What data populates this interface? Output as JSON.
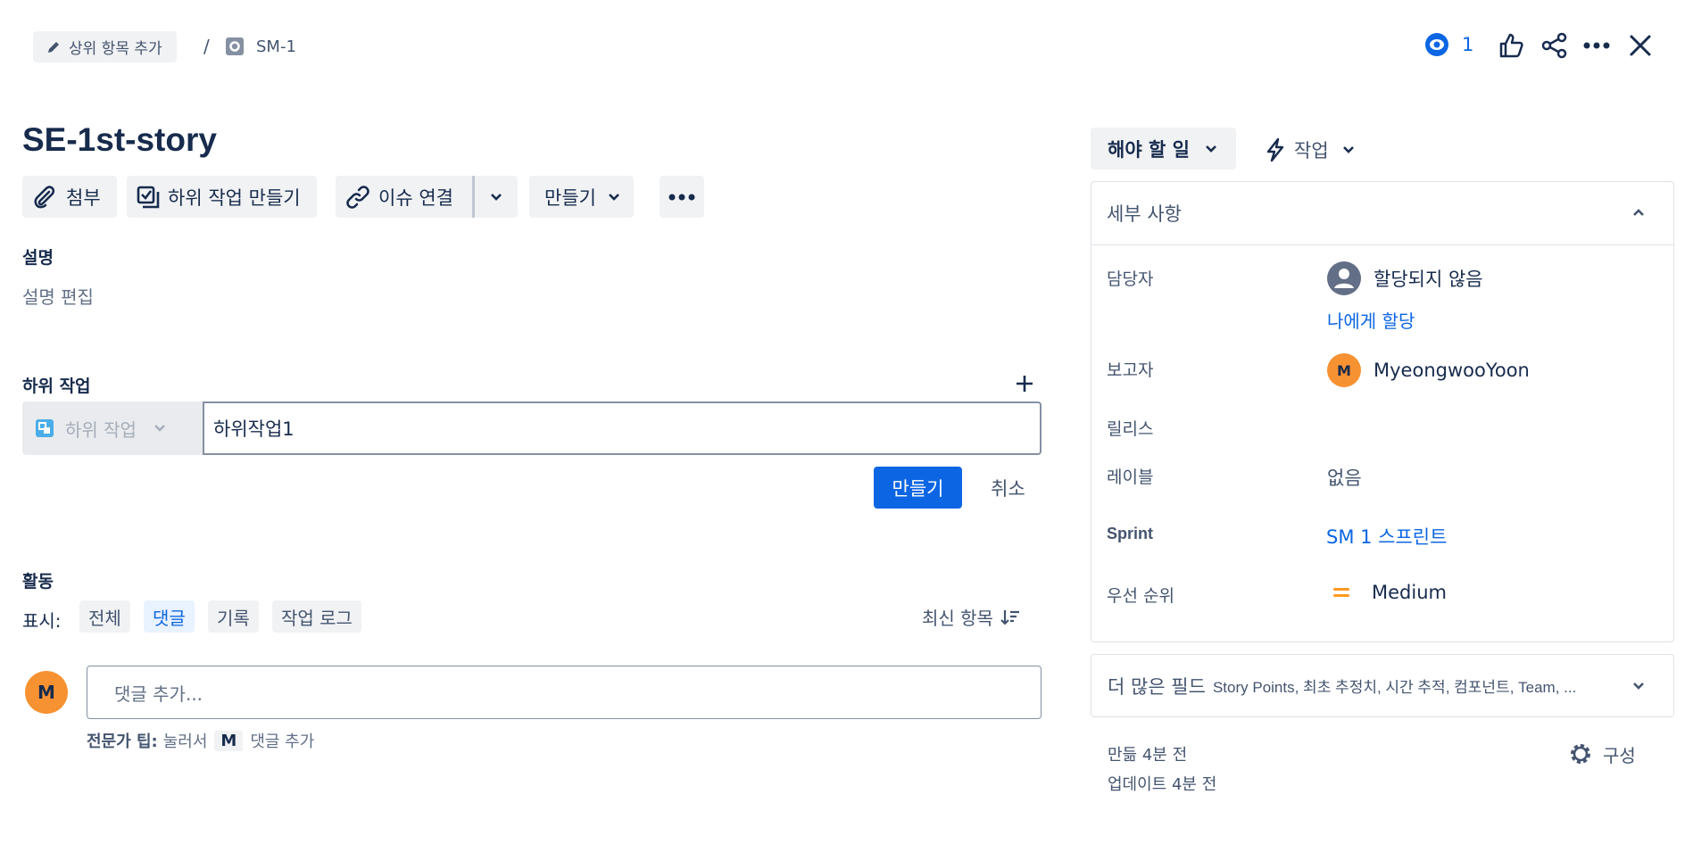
{
  "breadcrumb": {
    "add_parent": "상위 항목 추가",
    "separator": "/",
    "issue_key": "SM-1"
  },
  "header_actions": {
    "watch_count": "1"
  },
  "issue": {
    "title": "SE-1st-story"
  },
  "toolbar": {
    "attach": "첨부",
    "create_subtask": "하위 작업 만들기",
    "link_issue": "이슈 연결",
    "create": "만들기"
  },
  "description": {
    "heading": "설명",
    "placeholder": "설명 편집"
  },
  "subtasks": {
    "heading": "하위 작업",
    "type_label": "하위 작업",
    "input_value": "하위작업1",
    "create_button": "만들기",
    "cancel_button": "취소"
  },
  "activity": {
    "heading": "활동",
    "show_label": "표시:",
    "filters": [
      "전체",
      "댓글",
      "기록",
      "작업 로그"
    ],
    "active_filter": "댓글",
    "sort_label": "최신 항목",
    "avatar_initial": "M",
    "comment_placeholder": "댓글 추가...",
    "tip_bold": "전문가 팁:",
    "tip_text": "눌러서",
    "tip_key": "M",
    "tip_suffix": "댓글 추가"
  },
  "status": {
    "current": "해야 할 일",
    "action": "작업"
  },
  "details": {
    "heading": "세부 사항",
    "assignee_label": "담당자",
    "assignee_value": "할당되지 않음",
    "assign_to_me": "나에게 할당",
    "reporter_label": "보고자",
    "reporter_initial": "M",
    "reporter_value": "MyeongwooYoon",
    "release_label": "릴리스",
    "labels_label": "레이블",
    "labels_value": "없음",
    "sprint_label": "Sprint",
    "sprint_value": "SM 1 스프린트",
    "priority_label": "우선 순위",
    "priority_value": "Medium"
  },
  "more_fields": {
    "title": "더 많은 필드",
    "summary": "Story Points, 최초 추정치, 시간 추적, 컴포넌트, Team, ..."
  },
  "meta": {
    "created": "만듦 4분 전",
    "updated": "업데이트 4분 전",
    "configure": "구성"
  },
  "colors": {
    "primary": "#0c66e4",
    "avatar": "#f79232",
    "priority": "#ff991f",
    "grey_bg": "#f1f2f4"
  }
}
